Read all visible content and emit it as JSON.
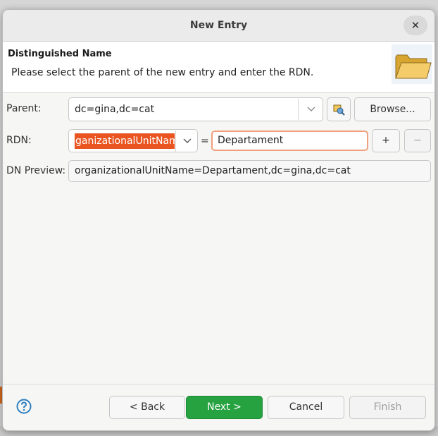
{
  "window": {
    "title": "New Entry"
  },
  "header": {
    "title": "Distinguished Name",
    "description": "Please select the parent of the new entry and enter the RDN."
  },
  "form": {
    "parent_label": "Parent:",
    "parent_value": "dc=gina,dc=cat",
    "browse_label": "Browse...",
    "rdn_label": "RDN:",
    "rdn_attribute": "ganizationalUnitNam",
    "equals": "=",
    "rdn_value": "Departament",
    "add_label": "+",
    "remove_label": "−",
    "preview_label": "DN Preview:",
    "preview_value": "organizationalUnitName=Departament,dc=gina,dc=cat"
  },
  "footer": {
    "back_label": "< Back",
    "next_label": "Next >",
    "cancel_label": "Cancel",
    "finish_label": "Finish"
  },
  "colors": {
    "accent_selection": "#e95420",
    "primary_button": "#26a241",
    "focus_border": "#f0a07c",
    "help_icon": "#2d7fc0"
  },
  "icons": {
    "close": "close-icon",
    "header": "folder-icon",
    "parent_picker": "ldap-tree-icon",
    "combo_arrow": "chevron-down-icon",
    "help": "help-icon"
  }
}
